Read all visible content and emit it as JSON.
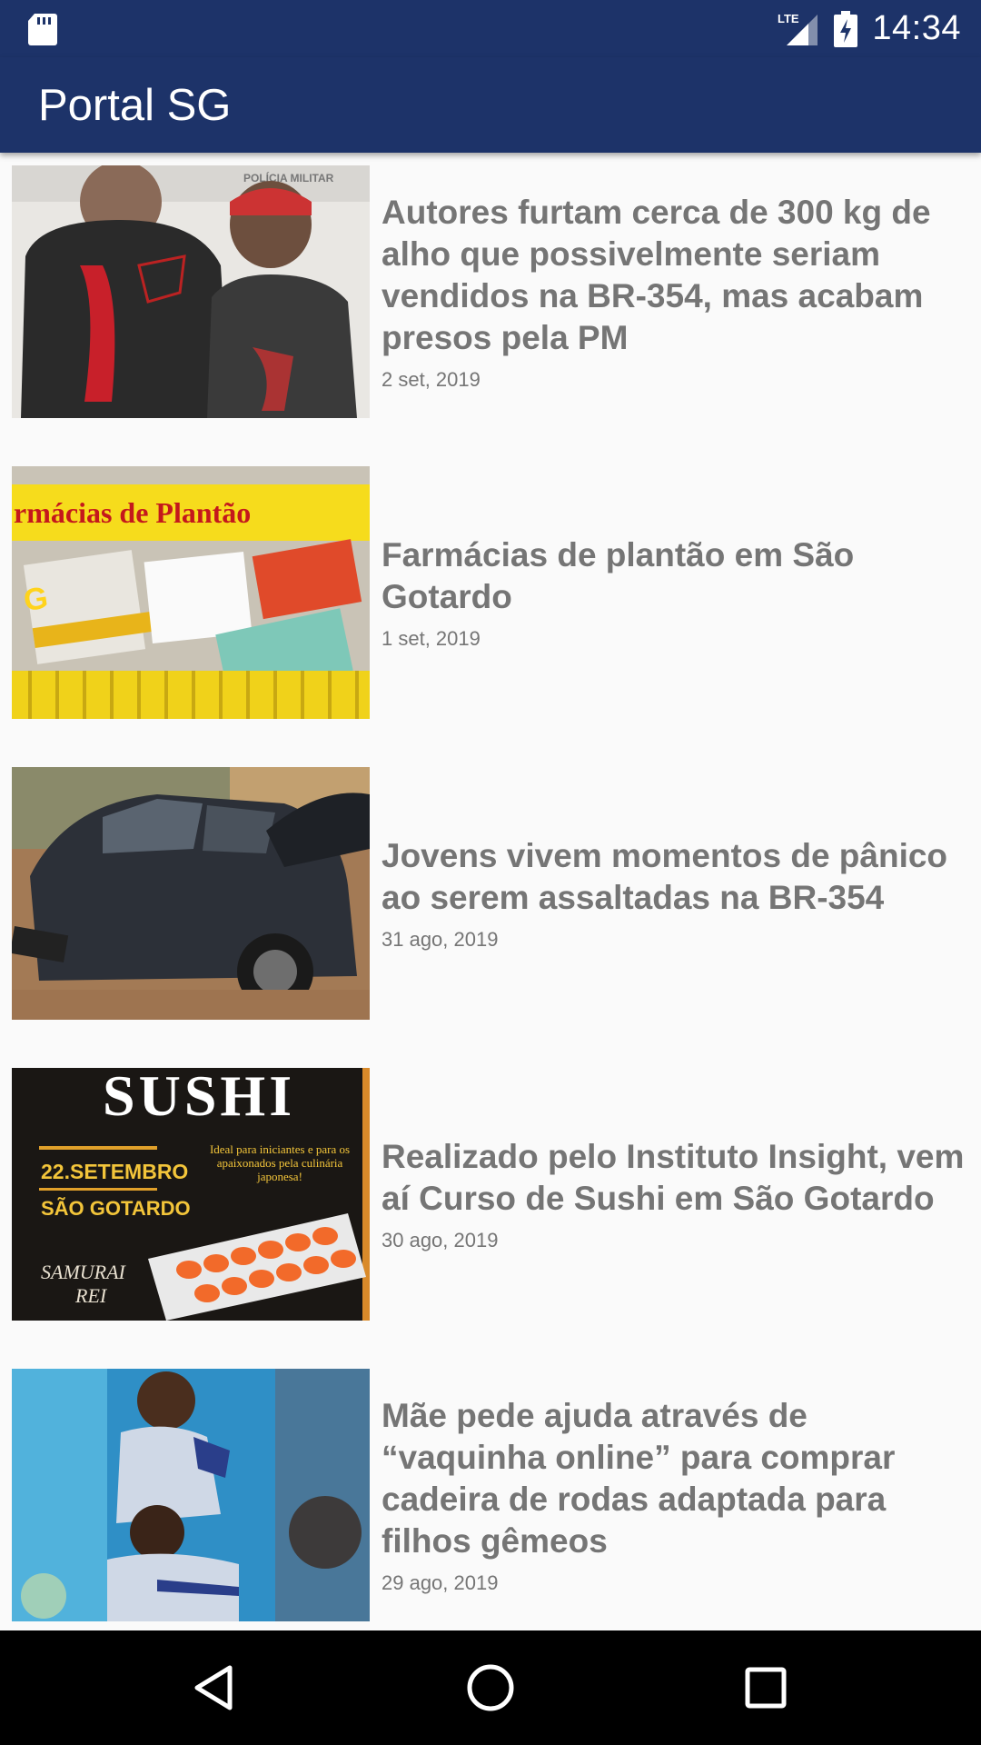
{
  "status_bar": {
    "time": "14:34",
    "network": "LTE",
    "icons": [
      "sd-card-icon",
      "lte-signal-icon",
      "battery-charging-icon"
    ]
  },
  "app_bar": {
    "title": "Portal SG"
  },
  "articles": [
    {
      "headline": "Autores furtam cerca de 300 kg de alho que possivelmente seriam vendidos na BR-354, mas acabam presos pela PM",
      "date": "2 set, 2019",
      "thumb_label": "POLÍCIA MILITAR"
    },
    {
      "headline": "Farmácias de plantão em São Gotardo",
      "date": "1 set, 2019",
      "thumb_label": "rmácias de Plantão"
    },
    {
      "headline": "Jovens vivem momentos de pânico ao serem assaltadas na BR-354",
      "date": "31 ago, 2019"
    },
    {
      "headline": "Realizado pelo Instituto Insight, vem aí Curso de Sushi em São Gotardo",
      "date": "30 ago, 2019",
      "thumb_text": {
        "title": "SUSHI",
        "date": "22.SETEMBRO",
        "city": "SÃO GOTARDO",
        "tagline": "Ideal para iniciantes e para os apaixonados pela culinária japonesa!",
        "brand_1": "SAMURAI",
        "brand_2": "REI"
      }
    },
    {
      "headline": "Mãe pede ajuda através de “vaquinha online” para comprar cadeira de rodas adaptada para filhos gêmeos",
      "date": "29 ago, 2019"
    }
  ],
  "nav_bar": {
    "buttons": [
      "back-icon",
      "home-icon",
      "recents-icon"
    ]
  },
  "colors": {
    "primary": "#1d3369",
    "background": "#fafafa",
    "text": "#757575"
  }
}
